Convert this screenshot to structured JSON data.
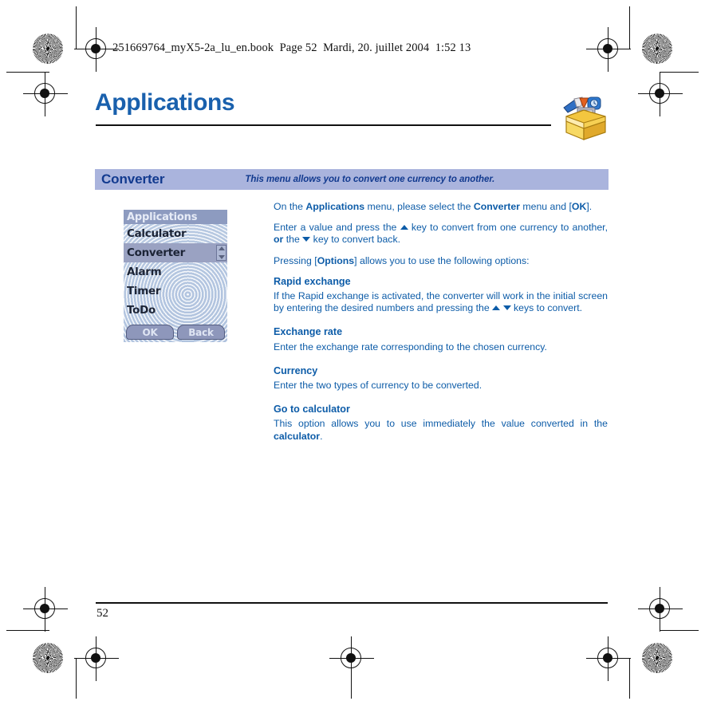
{
  "print_marks": {
    "file_header": "251669764_myX5-2a_lu_en.book  Page 52  Mardi, 20. juillet 2004  1:52 13"
  },
  "chapter": {
    "title": "Applications",
    "icon": "toolbox-icon"
  },
  "banner": {
    "title": "Converter",
    "subtitle": "This menu allows you to convert one currency to another."
  },
  "phone_screen": {
    "titlebar": "Applications",
    "items": [
      {
        "label": "Calculator",
        "selected": false
      },
      {
        "label": "Converter",
        "selected": true
      },
      {
        "label": "Alarm",
        "selected": false
      },
      {
        "label": "Timer",
        "selected": false
      },
      {
        "label": "ToDo",
        "selected": false
      }
    ],
    "softkeys": {
      "left": "OK",
      "right": "Back"
    },
    "scrollbar": {
      "up_icon": "chevron-up-icon",
      "down_icon": "chevron-down-icon"
    }
  },
  "body": {
    "intro_p1_a": "On the ",
    "intro_p1_b": "Applications",
    "intro_p1_c": " menu, please select the ",
    "intro_p1_d": "Converter",
    "intro_p1_e": " menu and [",
    "intro_p1_f": "OK",
    "intro_p1_g": "].",
    "intro_p2_a": "Enter a value and press the ",
    "intro_p2_b": " key to convert from one currency to another, ",
    "intro_p2_c": "or",
    "intro_p2_d": " the ",
    "intro_p2_e": " key to convert back.",
    "intro_p3_a": "Pressing [",
    "intro_p3_b": "Options",
    "intro_p3_c": "] allows you to use the following options:",
    "sections": [
      {
        "heading": "Rapid exchange",
        "text_a": "If the Rapid exchange is activated, the converter will work in the initial screen by entering the desired numbers and pressing the ",
        "text_b": " ",
        "text_c": " keys to convert."
      },
      {
        "heading": "Exchange rate",
        "text": "Enter the exchange rate corresponding to the chosen currency."
      },
      {
        "heading": "Currency",
        "text": "Enter the two types of currency to be converted."
      },
      {
        "heading": "Go to calculator",
        "text_a": "This option allows you to use immediately the value converted in the ",
        "text_b": "calculator",
        "text_c": "."
      }
    ]
  },
  "footer": {
    "page_number": "52"
  },
  "colors": {
    "heading_blue": "#1960ad",
    "body_blue": "#0d5ca8",
    "banner_bg": "#aab4dd",
    "banner_text": "#123a8f",
    "phone_titlebar": "#8d9bc0",
    "phone_selected": "#9aa2c2"
  }
}
